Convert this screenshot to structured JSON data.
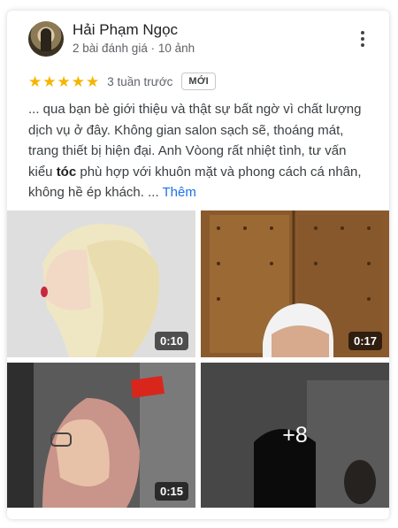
{
  "reviewer": {
    "name": "Hải Phạm Ngọc",
    "meta": "2 bài đánh giá · 10 ảnh"
  },
  "rating": {
    "stars": 5,
    "time": "3 tuần trước",
    "badge": "MỚI"
  },
  "review": {
    "text_before": "... qua bạn bè giới thiệu và thật sự bất ngờ vì chất lượng dịch vụ ở đây. Không gian salon sạch sẽ, thoáng mát, trang thiết bị hiện đại. Anh Vòong rất nhiệt tình, tư vấn kiểu ",
    "highlight": "tóc",
    "text_after": " phù hợp với khuôn mặt và phong cách cá nhân, không hề ép khách. ... ",
    "more_label": "Thêm"
  },
  "media": [
    {
      "duration": "0:10"
    },
    {
      "duration": "0:17"
    },
    {
      "duration": "0:15"
    },
    {
      "overlay": "+8"
    }
  ],
  "icons": {
    "star": "star-icon",
    "more": "more-vert-icon"
  },
  "colors": {
    "star": "#f6b400",
    "link": "#1a73e8"
  }
}
